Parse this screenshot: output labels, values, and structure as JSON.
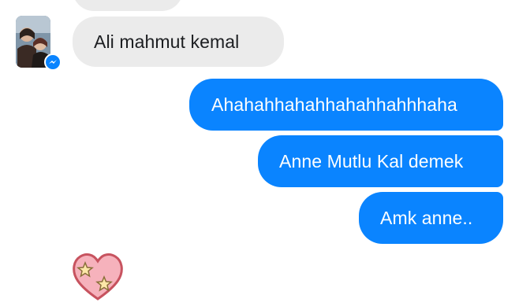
{
  "conversation": {
    "contact": {
      "avatar_icon": "profile-photo",
      "badge_icon": "messenger-icon"
    },
    "messages": [
      {
        "direction": "incoming",
        "text": "Ali  mahmut kemal"
      },
      {
        "direction": "outgoing",
        "text": "Ahahahhahahhahahhahhhaha"
      },
      {
        "direction": "outgoing",
        "text": "Anne Mutlu Kal demek"
      },
      {
        "direction": "outgoing",
        "text": "Amk anne.."
      }
    ],
    "sticker": {
      "icon": "heart-stars-sticker"
    }
  },
  "colors": {
    "outgoing_bubble": "#0a84ff",
    "incoming_bubble": "#ebebeb",
    "background": "#ffffff"
  }
}
